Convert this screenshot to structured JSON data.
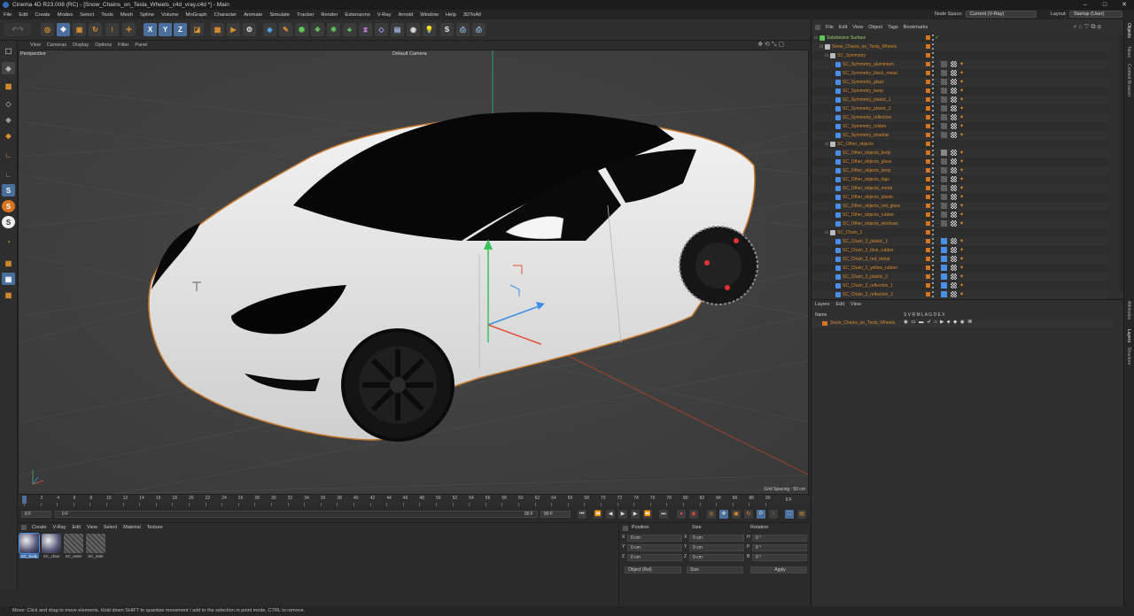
{
  "title": "Cinema 4D R23.008 (RC) - [Snow_Chains_on_Tesla_Wheels_c4d_vray.c4d *] - Main",
  "menu": [
    "File",
    "Edit",
    "Create",
    "Modes",
    "Select",
    "Tools",
    "Mesh",
    "Spline",
    "Volume",
    "MoGraph",
    "Character",
    "Animate",
    "Simulate",
    "Tracker",
    "Render",
    "Extensions",
    "V-Ray",
    "Arnold",
    "Window",
    "Help",
    "3DToAll"
  ],
  "node_space_label": "Node Space:",
  "node_space_value": "Current (V-Ray)",
  "layout_label": "Layout:",
  "layout_value": "Startup (User)",
  "viewport_menu": [
    "View",
    "Cameras",
    "Display",
    "Options",
    "Filter",
    "Panel"
  ],
  "viewport_name": "Perspective",
  "camera_label": "Default Camera",
  "grid_spacing": "Grid Spacing : 50 cm",
  "timeline_ticks": [
    "0",
    "2",
    "4",
    "6",
    "8",
    "10",
    "12",
    "14",
    "16",
    "18",
    "20",
    "22",
    "24",
    "26",
    "28",
    "30",
    "32",
    "34",
    "36",
    "38",
    "40",
    "42",
    "44",
    "46",
    "48",
    "50",
    "52",
    "54",
    "56",
    "58",
    "60",
    "62",
    "64",
    "66",
    "68",
    "70",
    "72",
    "74",
    "76",
    "78",
    "80",
    "82",
    "84",
    "86",
    "88",
    "90"
  ],
  "frame_end_marker": "0 F",
  "transport": {
    "start_field": "0 F",
    "range_start": "0 F",
    "range_end": "90 F",
    "end_field": "90 F"
  },
  "materials_menu": [
    "Create",
    "V-Ray",
    "Edit",
    "View",
    "Select",
    "Material",
    "Texture"
  ],
  "materials": [
    "SC_body",
    "SC_chair",
    "SC_exter",
    "SC_inter"
  ],
  "coords": {
    "headers": [
      "Position",
      "Size",
      "Rotation"
    ],
    "rows": [
      {
        "axis": "X",
        "pos": "0 cm",
        "size": "0 cm",
        "rot_axis": "H",
        "rot": "0 °"
      },
      {
        "axis": "Y",
        "pos": "0 cm",
        "size": "0 cm",
        "rot_axis": "P",
        "rot": "0 °"
      },
      {
        "axis": "Z",
        "pos": "0 cm",
        "size": "0 cm",
        "rot_axis": "B",
        "rot": "0 °"
      }
    ],
    "mode": "Object (Rel)",
    "size_mode": "Size",
    "apply": "Apply"
  },
  "object_menu": [
    "File",
    "Edit",
    "View",
    "Object",
    "Tags",
    "Bookmarks"
  ],
  "objects": [
    {
      "name": "Subdivision Surface",
      "indent": 0,
      "color": "#9fd26a",
      "tags": "none"
    },
    {
      "name": "Snow_Chains_on_Tesla_Wheels",
      "indent": 1,
      "color": "#d88a2e",
      "tags": "none"
    },
    {
      "name": "SC_Symmetry",
      "indent": 2,
      "color": "#d88a2e",
      "tags": "none"
    },
    {
      "name": "SC_Symmetry_aluminium",
      "indent": 3,
      "color": "#d88a2e",
      "tags": "mat"
    },
    {
      "name": "SC_Symmetry_black_metal",
      "indent": 3,
      "color": "#d88a2e",
      "tags": "mat"
    },
    {
      "name": "SC_Symmetry_glass",
      "indent": 3,
      "color": "#d88a2e",
      "tags": "mat"
    },
    {
      "name": "SC_Symmetry_lamp",
      "indent": 3,
      "color": "#d88a2e",
      "tags": "mat"
    },
    {
      "name": "SC_Symmetry_plastic_1",
      "indent": 3,
      "color": "#d88a2e",
      "tags": "mat"
    },
    {
      "name": "SC_Symmetry_plastic_2",
      "indent": 3,
      "color": "#d88a2e",
      "tags": "mat"
    },
    {
      "name": "SC_Symmetry_reflection",
      "indent": 3,
      "color": "#d88a2e",
      "tags": "mat"
    },
    {
      "name": "SC_Symmetry_rubber",
      "indent": 3,
      "color": "#d88a2e",
      "tags": "mat"
    },
    {
      "name": "SC_Symmetry_shadow",
      "indent": 3,
      "color": "#d88a2e",
      "tags": "mat"
    },
    {
      "name": "SC_Other_objects",
      "indent": 2,
      "color": "#d88a2e",
      "tags": "none"
    },
    {
      "name": "SC_Other_objects_body",
      "indent": 3,
      "color": "#d88a2e",
      "tags": "mat2"
    },
    {
      "name": "SC_Other_objects_glass",
      "indent": 3,
      "color": "#d88a2e",
      "tags": "mat"
    },
    {
      "name": "SC_Other_objects_lamp",
      "indent": 3,
      "color": "#d88a2e",
      "tags": "mat"
    },
    {
      "name": "SC_Other_objects_logo",
      "indent": 3,
      "color": "#d88a2e",
      "tags": "mat"
    },
    {
      "name": "SC_Other_objects_metal",
      "indent": 3,
      "color": "#d88a2e",
      "tags": "mat"
    },
    {
      "name": "SC_Other_objects_plastic",
      "indent": 3,
      "color": "#d88a2e",
      "tags": "mat"
    },
    {
      "name": "SC_Other_objects_red_glass",
      "indent": 3,
      "color": "#d88a2e",
      "tags": "mat"
    },
    {
      "name": "SC_Other_objects_rubber",
      "indent": 3,
      "color": "#d88a2e",
      "tags": "mat"
    },
    {
      "name": "SC_Other_objects_windows",
      "indent": 3,
      "color": "#d88a2e",
      "tags": "mat"
    },
    {
      "name": "SC_Chain_2",
      "indent": 2,
      "color": "#d88a2e",
      "tags": "none"
    },
    {
      "name": "SC_Chain_2_plastic_1",
      "indent": 3,
      "color": "#d88a2e",
      "tags": "chain"
    },
    {
      "name": "SC_Chain_2_blue_rubber",
      "indent": 3,
      "color": "#d88a2e",
      "tags": "chain"
    },
    {
      "name": "SC_Chain_2_red_metal",
      "indent": 3,
      "color": "#d88a2e",
      "tags": "chain"
    },
    {
      "name": "SC_Chain_2_yellow_rubber",
      "indent": 3,
      "color": "#d88a2e",
      "tags": "chain"
    },
    {
      "name": "SC_Chain_2_plastic_2",
      "indent": 3,
      "color": "#d88a2e",
      "tags": "chain"
    },
    {
      "name": "SC_Chain_2_reflection_1",
      "indent": 3,
      "color": "#d88a2e",
      "tags": "chain"
    },
    {
      "name": "SC_Chain_2_reflection_2",
      "indent": 3,
      "color": "#d88a2e",
      "tags": "chain"
    }
  ],
  "layer_menu": [
    "Layers",
    "Edit",
    "View"
  ],
  "layer_header": {
    "name": "Name",
    "flags": "S V R M L A G D E X"
  },
  "layers": [
    {
      "name": "Snow_Chains_on_Tesla_Wheels"
    }
  ],
  "right_tabs_top": [
    "Objects",
    "Takes",
    "Content Browser"
  ],
  "right_tabs_bottom": [
    "Attributes",
    "Layers",
    "Structure"
  ],
  "status": "Move: Click and drag to move elements. Hold down SHIFT to quantize movement / add to the selection in point mode, CTRL to remove."
}
